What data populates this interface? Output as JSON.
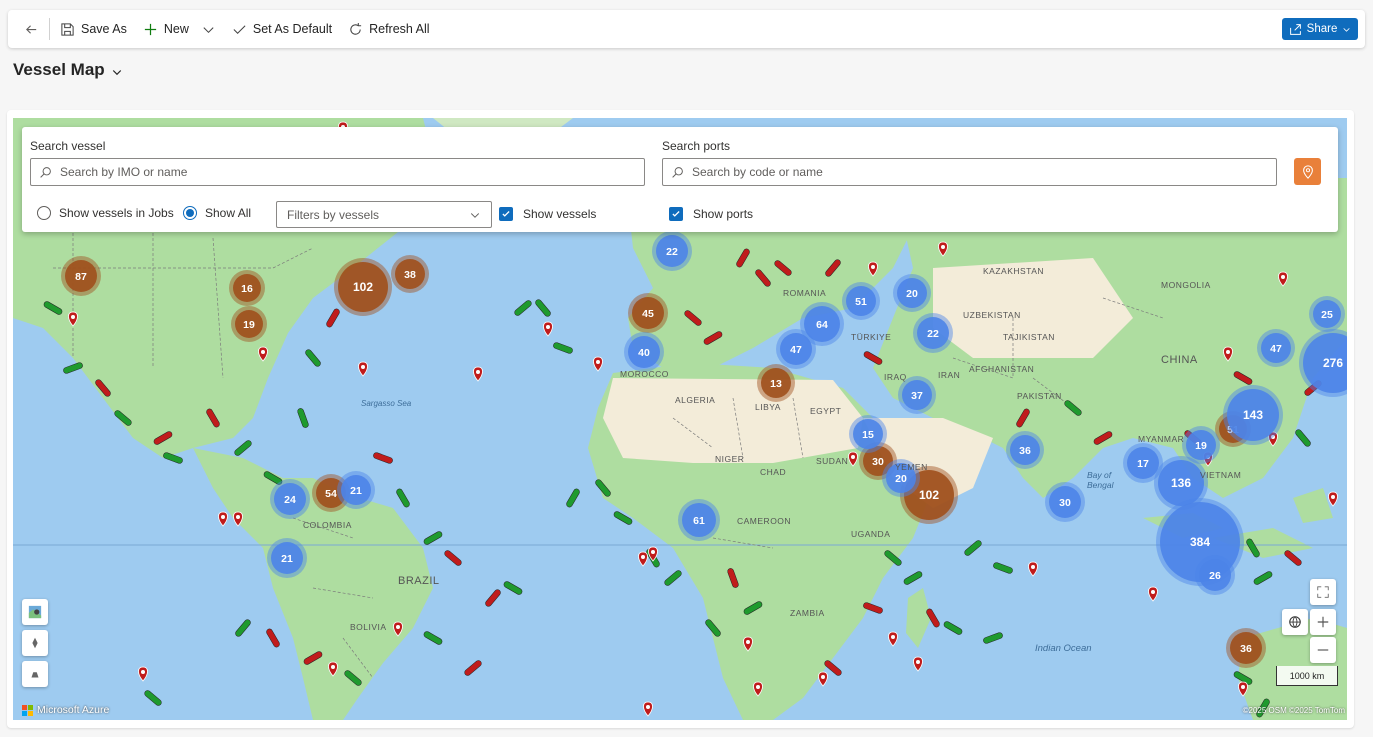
{
  "toolbar": {
    "save_as": "Save As",
    "new": "New",
    "set_default": "Set As Default",
    "refresh_all": "Refresh All",
    "share": "Share"
  },
  "page": {
    "title": "Vessel Map"
  },
  "search": {
    "vessel_label": "Search vessel",
    "vessel_placeholder": "Search by IMO or name",
    "ports_label": "Search ports",
    "ports_placeholder": "Search by code or name"
  },
  "filters": {
    "show_in_jobs": "Show vessels in Jobs",
    "show_all": "Show All",
    "selected_radio": "Show All",
    "vessel_filter_placeholder": "Filters by vessels",
    "show_vessels": "Show vessels",
    "show_vessels_checked": true,
    "show_ports": "Show ports",
    "show_ports_checked": true
  },
  "map": {
    "scale": "1000 km",
    "brand": "Microsoft Azure",
    "copyright": "©2025 OSM  ©2025 TomTom",
    "labels": {
      "kazakhstan": "KAZAKHSTAN",
      "mongolia": "MONGOLIA",
      "romania": "ROMANIA",
      "uzbekistan": "UZBEKISTAN",
      "tajikistan": "TAJIKISTAN",
      "turkiye": "TÜRKIYE",
      "china": "CHINA",
      "iraq": "IRAQ",
      "iran": "IRAN",
      "afghanistan": "AFGHANISTAN",
      "pakistan": "PAKISTAN",
      "morocco": "MOROCCO",
      "algeria": "ALGERIA",
      "libya": "LIBYA",
      "egypt": "EGYPT",
      "niger": "NIGER",
      "chad": "CHAD",
      "sudan": "SUDAN",
      "yemen": "YEMEN",
      "myanmar": "MYANMAR",
      "vietnam": "VIETNAM",
      "cameroon": "CAMEROON",
      "uganda": "UGANDA",
      "colombia": "COLOMBIA",
      "brazil": "BRAZIL",
      "bolivia": "BOLIVIA",
      "zambia": "ZAMBIA",
      "sargasso": "Sargasso Sea",
      "bay_of_bengal": "Bay of Bengal",
      "indian_ocean": "Indian Ocean"
    },
    "colors": {
      "land": "#aedda0",
      "desert": "#f3ecd9",
      "water": "#9ecbf0",
      "vessel_cluster": "#a0501c",
      "port_cluster": "#4c84e8",
      "vessel_green": "#1f9a2e",
      "vessel_red": "#c01c1c"
    },
    "clusters": {
      "vessel": [
        "87",
        "16",
        "19",
        "102",
        "38",
        "45",
        "13",
        "30",
        "102",
        "54",
        "51",
        "36"
      ],
      "port": [
        "22",
        "51",
        "64",
        "47",
        "20",
        "22",
        "40",
        "37",
        "15",
        "20",
        "36",
        "24",
        "21",
        "21",
        "61",
        "17",
        "19",
        "136",
        "30",
        "143",
        "47",
        "25",
        "276",
        "384",
        "26"
      ]
    }
  }
}
